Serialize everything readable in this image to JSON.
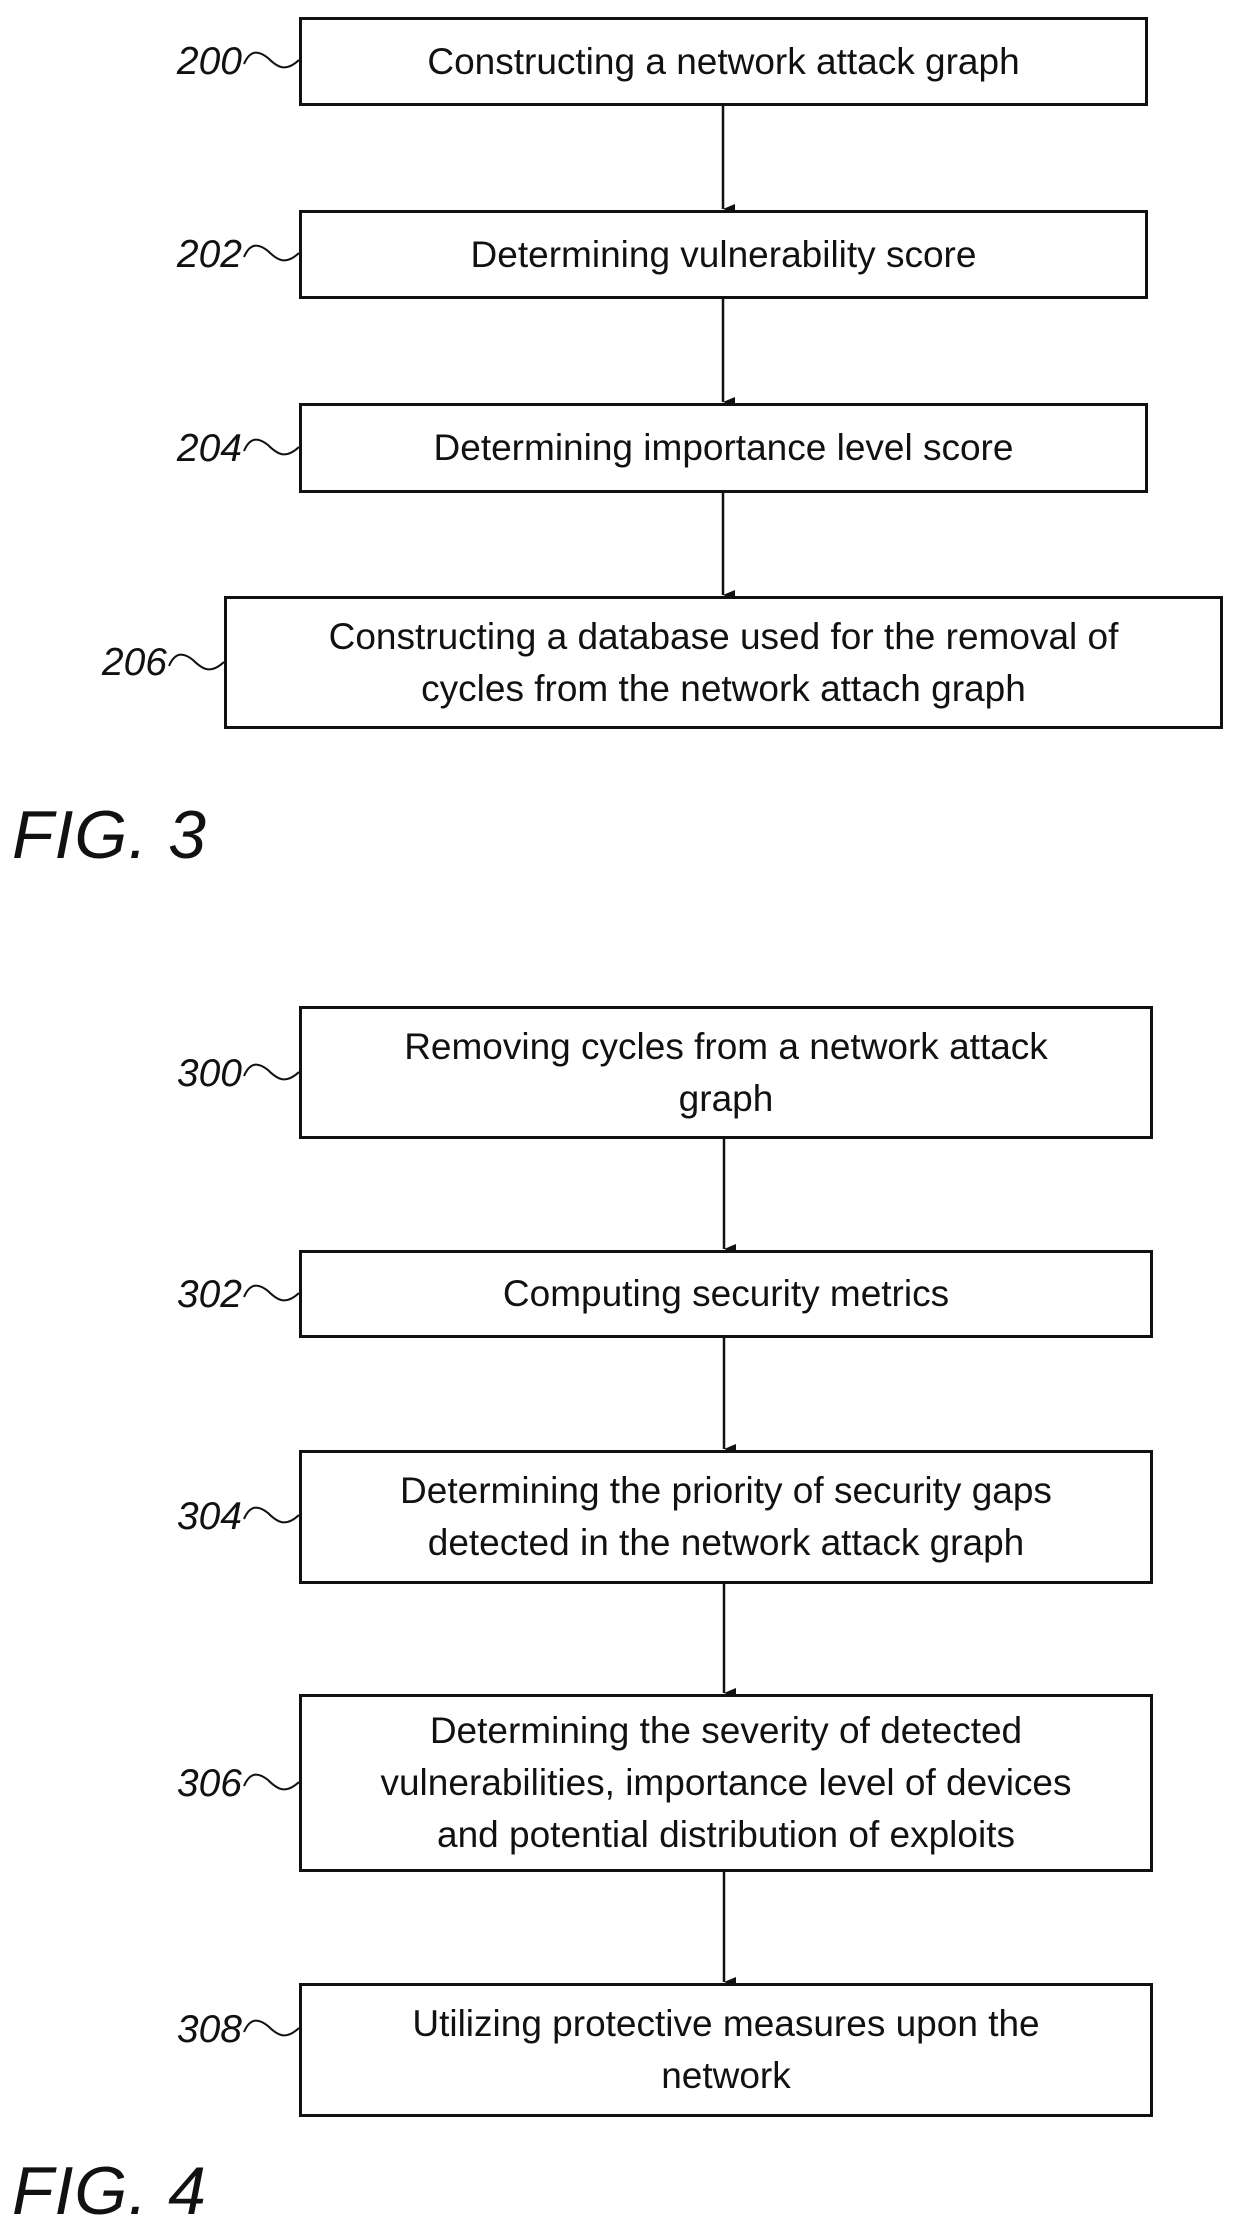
{
  "figures": [
    {
      "caption": "FIG. 3",
      "steps": [
        {
          "ref": "200",
          "text": "Constructing a network attack graph"
        },
        {
          "ref": "202",
          "text": "Determining vulnerability score"
        },
        {
          "ref": "204",
          "text": "Determining importance level score"
        },
        {
          "ref": "206",
          "text": "Constructing a database used for the removal of\ncycles from the network attach graph"
        }
      ]
    },
    {
      "caption": "FIG. 4",
      "steps": [
        {
          "ref": "300",
          "text": "Removing cycles from a network attack\ngraph"
        },
        {
          "ref": "302",
          "text": "Computing security metrics"
        },
        {
          "ref": "304",
          "text": "Determining the priority of security gaps\ndetected in the network attack graph"
        },
        {
          "ref": "306",
          "text": "Determining the severity of detected\nvulnerabilities, importance level of devices\nand potential distribution of exploits"
        },
        {
          "ref": "308",
          "text": "Utilizing protective measures upon the\nnetwork"
        }
      ]
    }
  ]
}
